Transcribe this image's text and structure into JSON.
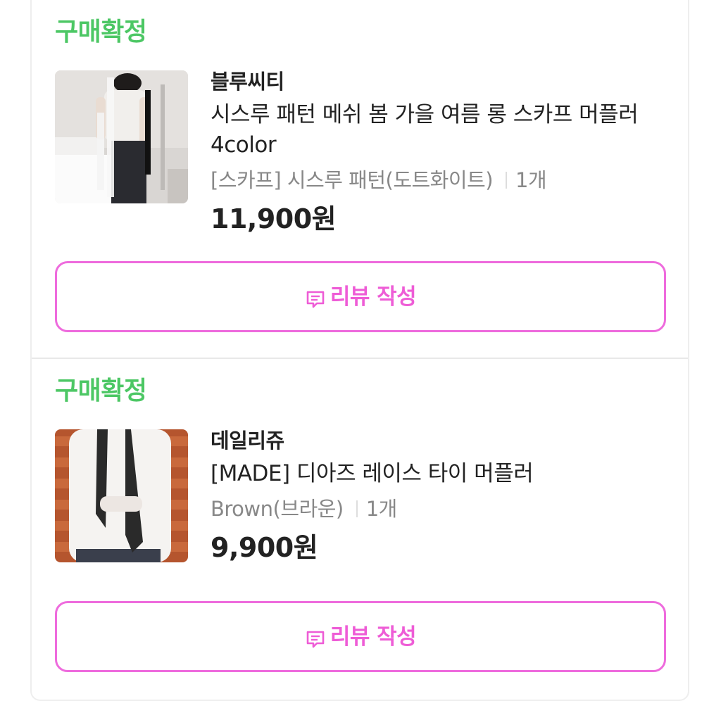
{
  "orders": [
    {
      "status": "구매확정",
      "brand": "블루씨티",
      "product_name": "시스루 패턴 메쉬 봄 가을 여름 롱 스카프 머플러 4color",
      "option": "[스카프] 시스루 패턴(도트화이트)",
      "quantity": "1개",
      "price": "11,900원",
      "review_button": "리뷰 작성",
      "thumbnail_icon": "product-photo-white-scarf"
    },
    {
      "status": "구매확정",
      "brand": "데일리쥬",
      "product_name": "[MADE] 디아즈 레이스 타이 머플러",
      "option": "Brown(브라운)",
      "quantity": "1개",
      "price": "9,900원",
      "review_button": "리뷰 작성",
      "thumbnail_icon": "product-photo-lace-tie"
    }
  ],
  "colors": {
    "status_green": "#4cc764",
    "review_pink": "#ee5cd6",
    "text_dark": "#222222",
    "text_gray": "#888888"
  },
  "icons": {
    "review": "comment-icon"
  }
}
